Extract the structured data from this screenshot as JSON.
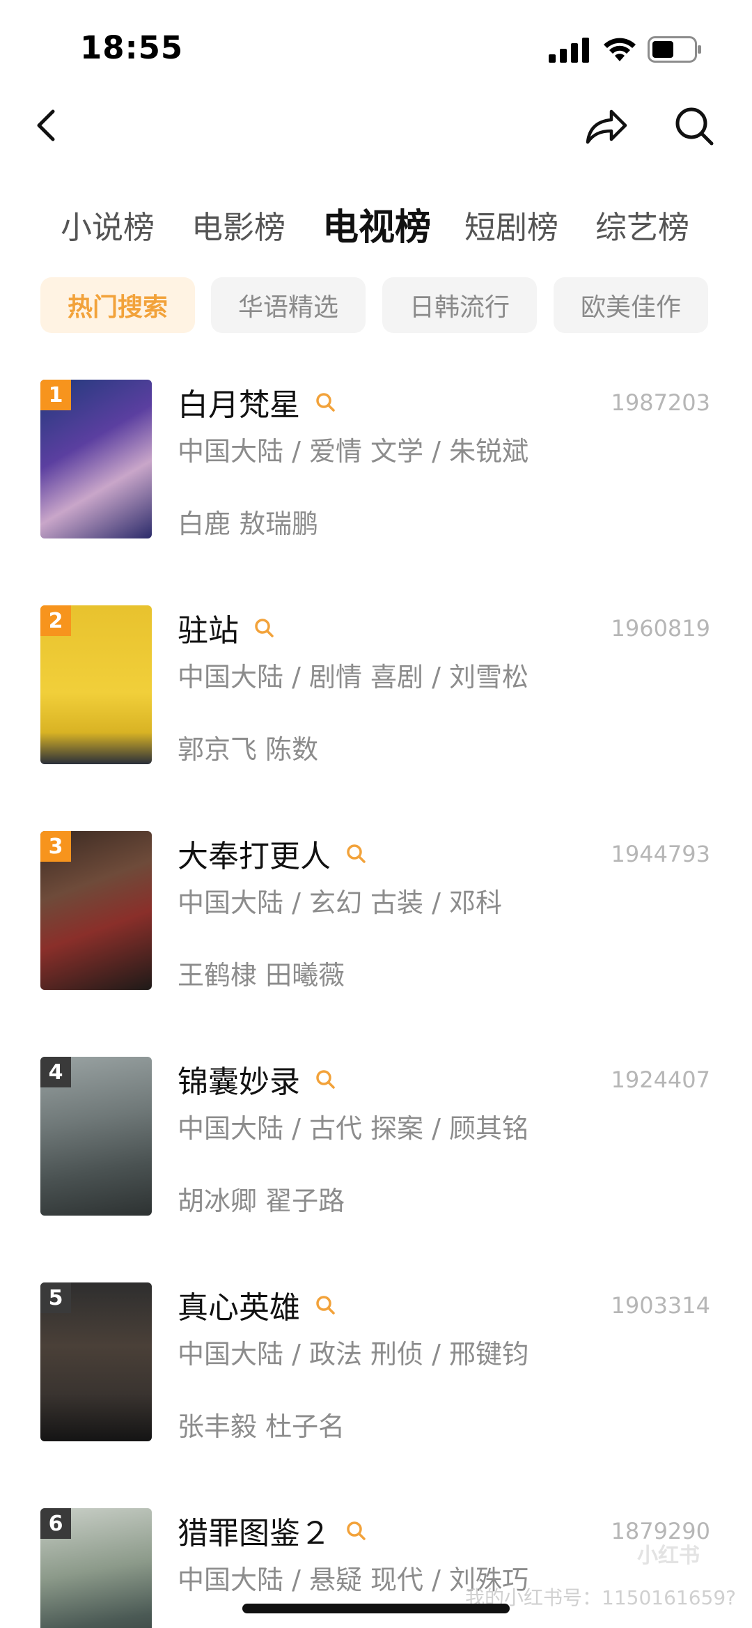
{
  "status_bar": {
    "time": "18:55"
  },
  "category_tabs": [
    {
      "label": "小说榜"
    },
    {
      "label": "电影榜"
    },
    {
      "label": "电视榜",
      "active": true
    },
    {
      "label": "短剧榜"
    },
    {
      "label": "综艺榜"
    }
  ],
  "chips": [
    {
      "label": "热门搜索",
      "active": true
    },
    {
      "label": "华语精选"
    },
    {
      "label": "日韩流行"
    },
    {
      "label": "欧美佳作"
    }
  ],
  "items": [
    {
      "rank": "1",
      "title": "白月梵星",
      "count": "1987203",
      "meta": "中国大陆 / 爱情 文学 / 朱锐斌",
      "cast": "白鹿 敖瑞鹏"
    },
    {
      "rank": "2",
      "title": "驻站",
      "count": "1960819",
      "meta": "中国大陆 / 剧情 喜剧 / 刘雪松",
      "cast": "郭京飞 陈数"
    },
    {
      "rank": "3",
      "title": "大奉打更人",
      "count": "1944793",
      "meta": "中国大陆 / 玄幻 古装 / 邓科",
      "cast": "王鹤棣 田曦薇"
    },
    {
      "rank": "4",
      "title": "锦囊妙录",
      "count": "1924407",
      "meta": "中国大陆 / 古代 探案 / 顾其铭",
      "cast": "胡冰卿 翟子路"
    },
    {
      "rank": "5",
      "title": "真心英雄",
      "count": "1903314",
      "meta": "中国大陆 / 政法 刑侦 / 邢键钧",
      "cast": "张丰毅 杜子名"
    },
    {
      "rank": "6",
      "title": "猎罪图鉴２",
      "count": "1879290",
      "meta": "中国大陆 / 悬疑 现代 / 刘殊巧",
      "cast": ""
    }
  ],
  "watermark": {
    "text": "我的小红书号：1150161659?",
    "logo": "小红书"
  },
  "colors": {
    "accent": "#f2a23a",
    "rank_top": "#f7941d",
    "rank_other": "#3a3a3a",
    "muted": "#8c8c8c"
  },
  "icons": [
    "back-icon",
    "share-icon",
    "search-icon",
    "signal-icon",
    "wifi-icon",
    "battery-icon"
  ]
}
